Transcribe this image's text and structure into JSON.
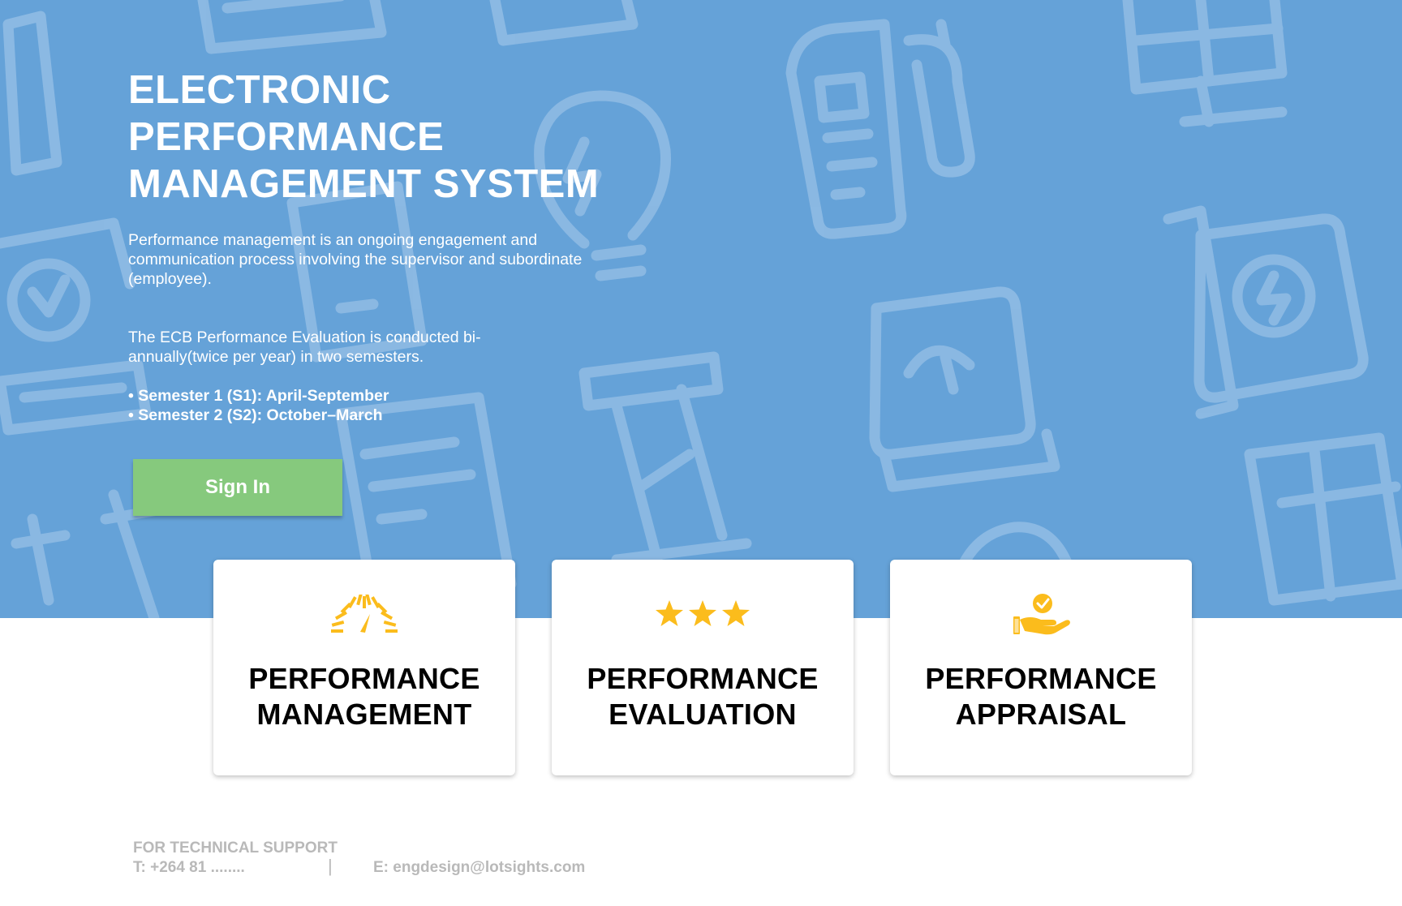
{
  "hero": {
    "title_lines": [
      "ELECTRONIC",
      "PERFORMANCE",
      "MANAGEMENT SYSTEM"
    ],
    "paragraph1": "Performance management is an ongoing engagement and communication process involving the supervisor and subordinate (employee).",
    "paragraph2": "The ECB Performance Evaluation is conducted bi-annually(twice per year) in two semesters.",
    "bullets": [
      "• Semester 1 (S1): April-September",
      "• Semester 2 (S2): October–March"
    ],
    "sign_in_label": "Sign In",
    "background_color": "#65a2d8",
    "button_color": "#86c97d"
  },
  "cards": [
    {
      "icon": "speedometer-icon",
      "title_lines": [
        "PERFORMANCE",
        "MANAGEMENT"
      ]
    },
    {
      "icon": "three-stars-icon",
      "title_lines": [
        "PERFORMANCE",
        "EVALUATION"
      ]
    },
    {
      "icon": "hand-checkmark-icon",
      "title_lines": [
        "PERFORMANCE",
        "APPRAISAL"
      ]
    }
  ],
  "icon_color": "#fbbc1c",
  "footer": {
    "heading": "FOR TECHNICAL SUPPORT",
    "phone": "T: +264 81 ........",
    "separator": "|",
    "email": "E: engdesign@lotsights.com"
  }
}
